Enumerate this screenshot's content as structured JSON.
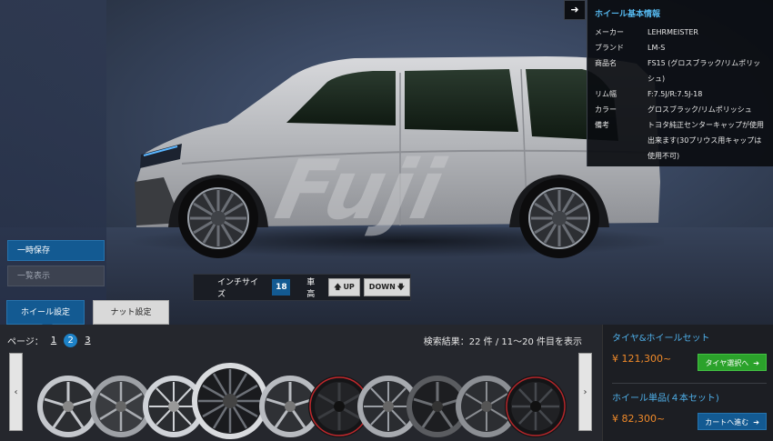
{
  "sidebar": {
    "save_label": "一時保存",
    "list_label": "一覧表示"
  },
  "size_bar": {
    "inch_label": "インチサイズ",
    "inch_value": "18",
    "height_label": "車高",
    "up_label": "UP",
    "down_label": "DOWN"
  },
  "info": {
    "title": "ホイール基本情報",
    "rows": [
      {
        "k": "メーカー",
        "v": "LEHRMEISTER"
      },
      {
        "k": "ブランド",
        "v": "LM-S"
      },
      {
        "k": "商品名",
        "v": "FS15 (グロスブラック/リムポリッシュ)"
      },
      {
        "k": "リム幅",
        "v": "F:7.5J/R:7.5J-18"
      },
      {
        "k": "カラー",
        "v": "グロスブラック/リムポリッシュ"
      },
      {
        "k": "備考",
        "v": "トヨタ純正センターキャップが使用出来ます(30プリウス用キャップは使用不可)"
      }
    ]
  },
  "tabs": {
    "wheel": "ホイール設定",
    "nut": "ナット設定"
  },
  "pager": {
    "label": "ページ：",
    "pages": [
      "1",
      "2",
      "3"
    ],
    "active": "2"
  },
  "result": {
    "text": "検索結果：22 件 / 11〜20 件目を表示"
  },
  "arrows": {
    "left": "‹",
    "right": "›"
  },
  "right": {
    "set_title": "タイヤ&ホイールセット",
    "set_price": "¥ 121,300~",
    "set_button": "タイヤ選択へ",
    "single_title": "ホイール単品(４本セット)",
    "single_price": "¥ 82,300~",
    "single_button": "カートへ進む"
  },
  "colors": {
    "accent": "#135a92",
    "link": "#4fb0ea",
    "price": "#f08a2a",
    "green": "#2ba22b"
  }
}
